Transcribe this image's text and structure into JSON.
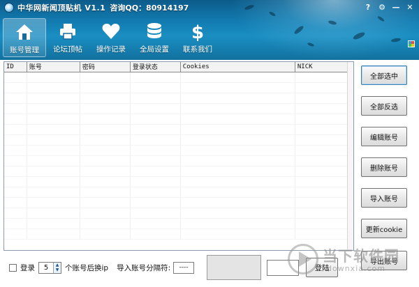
{
  "app": {
    "title": "中华网新闻顶贴机 V1.1",
    "contact": "咨询QQ：80914197"
  },
  "window_controls": [
    {
      "name": "help-icon",
      "glyph": "?"
    },
    {
      "name": "settings-icon",
      "glyph": "⚙"
    },
    {
      "name": "minimize-icon",
      "glyph": "—"
    },
    {
      "name": "close-icon",
      "glyph": "✕"
    }
  ],
  "nav": {
    "items": [
      {
        "label": "账号管理",
        "icon": "home-icon",
        "active": true
      },
      {
        "label": "论坛顶帖",
        "icon": "printer-icon",
        "active": false
      },
      {
        "label": "操作记录",
        "icon": "heart-icon",
        "active": false
      },
      {
        "label": "全局设置",
        "icon": "database-icon",
        "active": false
      },
      {
        "label": "联系我们",
        "icon": "dollar-icon",
        "active": false
      }
    ]
  },
  "table": {
    "columns": [
      "ID",
      "账号",
      "密码",
      "登录状态",
      "Cookies",
      "NICK"
    ],
    "rows": []
  },
  "side_buttons": {
    "select_all": "全部选中",
    "invert": "全部反选",
    "edit": "编辑账号",
    "delete": "删除账号",
    "import": "导入账号",
    "update_cookie": "更新cookie",
    "export": "导出账号"
  },
  "bottom": {
    "login_checkbox_label": "登录",
    "switch_count": "5",
    "switch_label": "个账号后换ip",
    "separator_label": "导入账号分隔符:",
    "separator_value": "----",
    "login_button": "登陆"
  },
  "watermark": {
    "cn": "当下软件园",
    "en": "downxia.com"
  }
}
